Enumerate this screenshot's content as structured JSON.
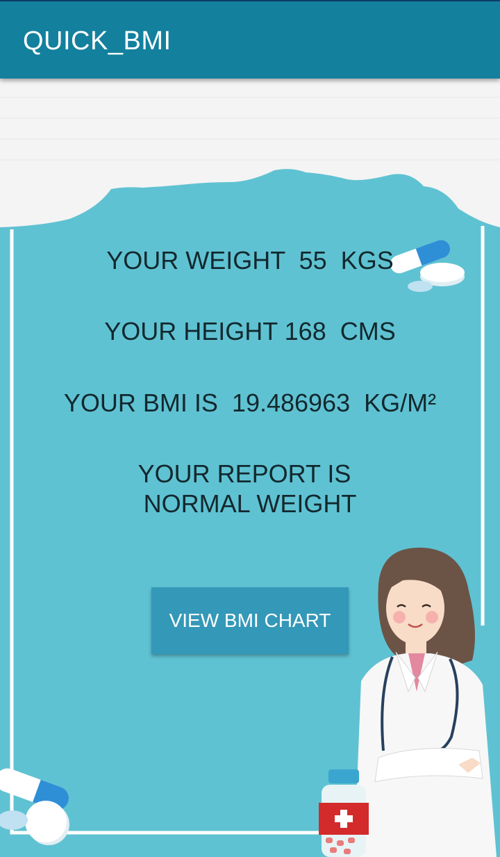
{
  "app_bar": {
    "title": "QUICK_BMI"
  },
  "results": {
    "weight_line": "YOUR WEIGHT  55  KGS",
    "height_line": "YOUR HEIGHT 168  CMS",
    "bmi_line": "YOUR BMI IS  19.486963  KG/M²",
    "report_label": "YOUR REPORT IS",
    "report_value": "NORMAL WEIGHT"
  },
  "actions": {
    "view_chart_label": "VIEW BMI CHART"
  },
  "colors": {
    "app_bar": "#13809e",
    "background": "#5fc2d2",
    "button": "#3498b8",
    "text": "#12282e"
  },
  "illustrations": [
    "pills-icon",
    "doctor-illustration",
    "medicine-bottle-icon",
    "cloud-frame"
  ]
}
